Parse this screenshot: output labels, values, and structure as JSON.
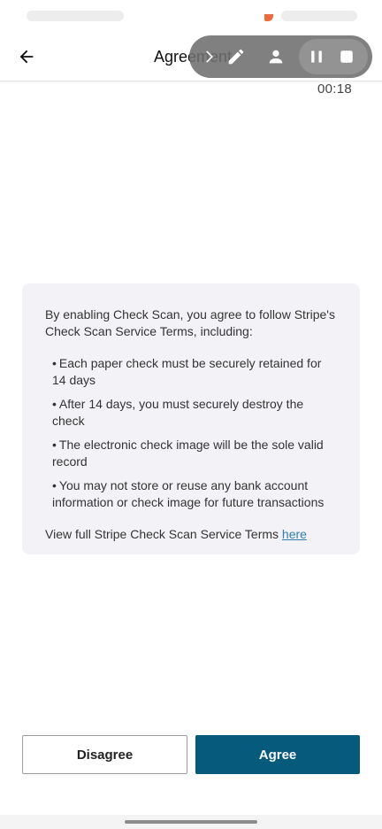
{
  "app_bar": {
    "title": "Agreement",
    "back_icon": "arrow-left-icon"
  },
  "recorder": {
    "timer": "00:18",
    "icons": [
      "chevron-right-icon",
      "pencil-icon",
      "person-icon",
      "pause-icon",
      "stop-icon"
    ]
  },
  "agreement": {
    "intro": "By enabling Check Scan, you agree to follow Stripe's Check Scan Service Terms, including:",
    "bullet_char": "•",
    "terms": [
      "Each paper check must be securely retained for 14 days",
      "After 14 days, you must securely destroy the check",
      "The electronic check image will be the sole valid record",
      "You may not store or reuse any bank account information or check image for future transactions"
    ],
    "footer_text": "View full Stripe Check Scan Service Terms",
    "link_text": "here"
  },
  "actions": {
    "disagree_label": "Disagree",
    "agree_label": "Agree"
  },
  "colors": {
    "accent": "#065a7c",
    "link": "#2f7fb0",
    "card_bg": "#f3f3f7",
    "status_dot": "#ee6a3c"
  }
}
